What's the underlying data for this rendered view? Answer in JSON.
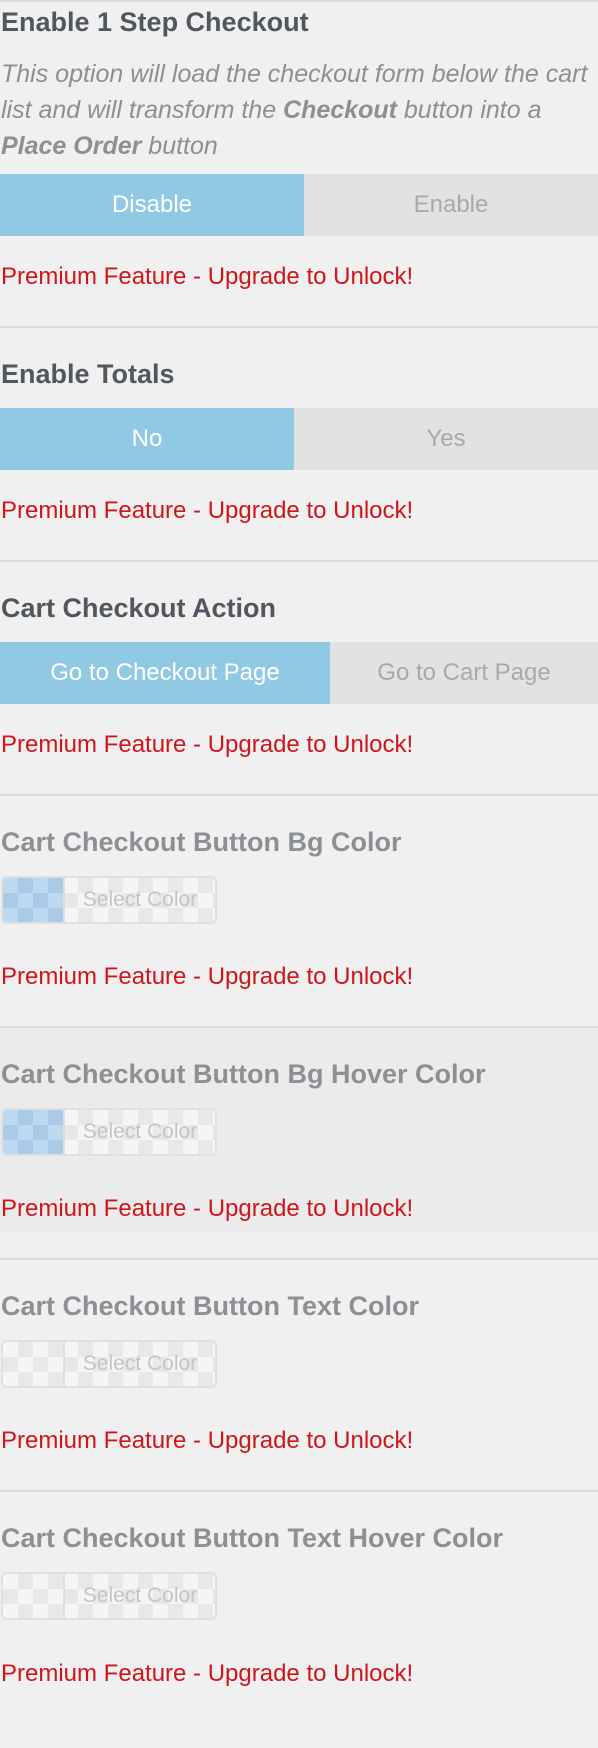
{
  "sections": [
    {
      "title": "Enable 1 Step Checkout",
      "description": {
        "part1": "This option will load the checkout form below the cart list and will transform the ",
        "bold1": "Checkout",
        "part2": " button into a ",
        "bold2": "Place Order",
        "part3": " button"
      },
      "options": [
        "Disable",
        "Enable"
      ],
      "selected": "Disable",
      "premium_notice": "Premium Feature - Upgrade to Unlock!"
    },
    {
      "title": "Enable Totals",
      "options": [
        "No",
        "Yes"
      ],
      "selected": "No",
      "premium_notice": "Premium Feature - Upgrade to Unlock!"
    },
    {
      "title": "Cart Checkout Action",
      "options": [
        "Go to Checkout Page",
        "Go to Cart Page"
      ],
      "selected": "Go to Checkout Page",
      "premium_notice": "Premium Feature - Upgrade to Unlock!"
    },
    {
      "title": "Cart Checkout Button Bg Color",
      "picker_label": "Select Color",
      "swatch": "light-blue",
      "premium_notice": "Premium Feature - Upgrade to Unlock!"
    },
    {
      "title": "Cart Checkout Button Bg Hover Color",
      "picker_label": "Select Color",
      "swatch": "light-blue",
      "premium_notice": "Premium Feature - Upgrade to Unlock!"
    },
    {
      "title": "Cart Checkout Button Text Color",
      "picker_label": "Select Color",
      "swatch": "transparent",
      "premium_notice": "Premium Feature - Upgrade to Unlock!"
    },
    {
      "title": "Cart Checkout Button Text Hover Color",
      "picker_label": "Select Color",
      "swatch": "transparent",
      "premium_notice": "Premium Feature - Upgrade to Unlock!"
    }
  ],
  "colors": {
    "active_toggle": "#91c9e4",
    "inactive_toggle": "#e2e2e2",
    "premium_text": "#d0161b",
    "background": "#f0f0f1"
  }
}
